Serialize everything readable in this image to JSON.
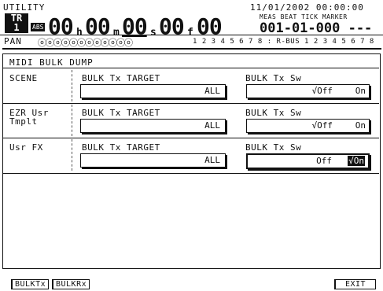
{
  "header": {
    "title": "UTILITY",
    "track_label": "TR",
    "track_number": "1",
    "abs_badge": "ABS",
    "time": {
      "h": "00",
      "m": "00",
      "s": "00",
      "f": "00",
      "sub": "00"
    },
    "time_units": {
      "h": "h",
      "m": "m",
      "s": "s",
      "f": "f"
    },
    "date": "11/01/2002 00:00:00",
    "mbt_header": "MEAS BEAT TICK MARKER",
    "mbt_value": "001-01-000 ---",
    "pan_label": "PAN",
    "knobs": "ⓞⓞⓞⓞⓞⓞⓞⓞⓞⓞⓞⓞ",
    "tracks": "1 2 3 4 5 6 7 8 : R-BUS 1 2 3 4 5 6 7 8"
  },
  "page_title": "MIDI BULK DUMP",
  "rows": [
    {
      "label": "SCENE",
      "target_label": "BULK Tx TARGET",
      "target_value": "ALL",
      "sw_label": "BULK Tx Sw",
      "sw_off": "√Off",
      "sw_on": "On",
      "selected": false
    },
    {
      "label": "EZR Usr\nTmplt",
      "target_label": "BULK Tx TARGET",
      "target_value": "ALL",
      "sw_label": "BULK Tx Sw",
      "sw_off": "√Off",
      "sw_on": "On",
      "selected": false
    },
    {
      "label": "Usr FX",
      "target_label": "BULK Tx TARGET",
      "target_value": "ALL",
      "sw_label": "BULK Tx Sw",
      "sw_off": "Off",
      "sw_on": "√On",
      "selected": true
    }
  ],
  "buttons": {
    "bulk_tx": "BULKTx",
    "bulk_rx": "BULKRx",
    "exit": "EXIT"
  }
}
